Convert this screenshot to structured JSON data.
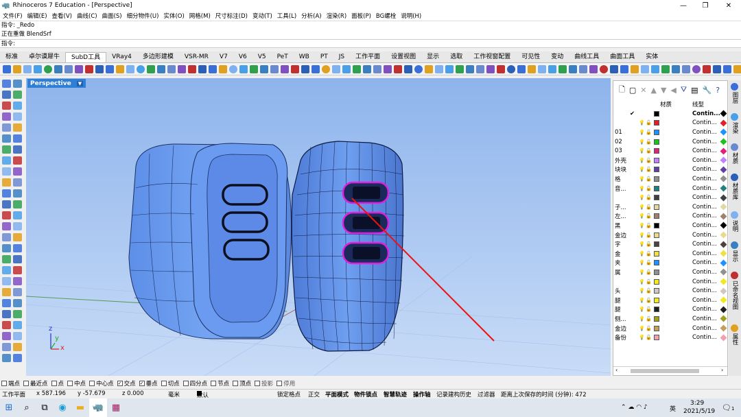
{
  "titlebar": {
    "title": "Rhinoceros 7 Education - [Perspective]",
    "min": "—",
    "max": "❐",
    "close": "✕"
  },
  "menu": [
    "文件(F)",
    "编辑(E)",
    "查看(V)",
    "曲线(C)",
    "曲面(S)",
    "细分物件(U)",
    "实体(O)",
    "网格(M)",
    "尺寸标注(D)",
    "变动(T)",
    "工具(L)",
    "分析(A)",
    "渲染(R)",
    "面板(P)",
    "BG螺栓",
    "说明(H)"
  ],
  "command_history": [
    "指令: _Redo",
    "正在重做 BlendSrf"
  ],
  "command_prompt": "指令:",
  "tabs": [
    "标准",
    "卓尔谟犀牛",
    "SubD工具",
    "VRay4",
    "多边形建模",
    "VSR-MR",
    "V7",
    "V6",
    "V5",
    "PeT",
    "WB",
    "PT",
    "JS",
    "工作平面",
    "设置视图",
    "显示",
    "选取",
    "工作视窗配置",
    "可见性",
    "变动",
    "曲线工具",
    "曲面工具",
    "实体"
  ],
  "active_tab": "SubD工具",
  "viewport": {
    "label": "Perspective",
    "axis_x": "x",
    "axis_y": "y",
    "axis_z": "z"
  },
  "layers": {
    "header_material": "材质",
    "header_linetype": "线型",
    "toolbar_icons": [
      "new-layer-icon",
      "new-sublayer-icon",
      "delete-icon",
      "move-up-icon",
      "move-down-icon",
      "move-parent-icon",
      "filter-icon",
      "properties-icon",
      "tools-icon",
      "help-icon"
    ],
    "rows": [
      {
        "name": "",
        "color": "#000000",
        "linetype": "Contin...",
        "current": true
      },
      {
        "name": "",
        "color": "#e0202a",
        "linetype": "Contin..."
      },
      {
        "name": "01",
        "color": "#1e90ff",
        "linetype": "Contin..."
      },
      {
        "name": "02",
        "color": "#20c020",
        "linetype": "Contin..."
      },
      {
        "name": "03",
        "color": "#e0207a",
        "linetype": "Contin..."
      },
      {
        "name": "外壳",
        "color": "#c080ff",
        "linetype": "Contin..."
      },
      {
        "name": "块块",
        "color": "#6040a0",
        "linetype": "Contin..."
      },
      {
        "name": "格",
        "color": "#909090",
        "linetype": "Contin..."
      },
      {
        "name": "音...",
        "color": "#208080",
        "linetype": "Contin..."
      },
      {
        "name": "",
        "color": "#404040",
        "linetype": "Contin..."
      },
      {
        "name": "子...",
        "color": "#e0d8a0",
        "linetype": "Contin..."
      },
      {
        "name": "左...",
        "color": "#a08070",
        "linetype": "Contin..."
      },
      {
        "name": "黑",
        "color": "#000000",
        "linetype": "Contin..."
      },
      {
        "name": "金边",
        "color": "#e8d890",
        "linetype": "Contin..."
      },
      {
        "name": "字",
        "color": "#504040",
        "linetype": "Contin..."
      },
      {
        "name": "金",
        "color": "#f0e040",
        "linetype": "Contin..."
      },
      {
        "name": "夹",
        "color": "#1e90ff",
        "linetype": "Contin..."
      },
      {
        "name": "属",
        "color": "#909090",
        "linetype": "Contin..."
      },
      {
        "name": "",
        "color": "#f0e820",
        "linetype": "Contin..."
      },
      {
        "name": "头",
        "color": "#d0c8c0",
        "linetype": "Contin..."
      },
      {
        "name": "腿",
        "color": "#f0e820",
        "linetype": "Contin..."
      },
      {
        "name": "腿",
        "color": "#202020",
        "linetype": "Contin..."
      },
      {
        "name": "侧...",
        "color": "#a0a020",
        "linetype": "Contin..."
      },
      {
        "name": "金边",
        "color": "#c0a060",
        "linetype": "Contin..."
      },
      {
        "name": "备份",
        "color": "#f0a0b0",
        "linetype": "Contin..."
      }
    ]
  },
  "side_tabs": [
    "图层",
    "渲染",
    "材质",
    "材质库",
    "说明",
    "显示",
    "已命名视图",
    "属性"
  ],
  "osnap": [
    {
      "label": "端点",
      "checked": false
    },
    {
      "label": "最近点",
      "checked": false
    },
    {
      "label": "点",
      "checked": false
    },
    {
      "label": "中点",
      "checked": false
    },
    {
      "label": "中心点",
      "checked": false
    },
    {
      "label": "交点",
      "checked": true
    },
    {
      "label": "垂点",
      "checked": true
    },
    {
      "label": "切点",
      "checked": false
    },
    {
      "label": "四分点",
      "checked": false
    },
    {
      "label": "节点",
      "checked": false
    },
    {
      "label": "顶点",
      "checked": false
    },
    {
      "label": "投影",
      "checked": false
    },
    {
      "label": "停用",
      "checked": false
    }
  ],
  "status": {
    "cplane": "工作平面",
    "x": "x 587.196",
    "y": "y -57.679",
    "z": "z 0.000",
    "unit": "毫米",
    "layer": "默认",
    "grid_snap": "锁定格点",
    "ortho": "正交",
    "planar": "平面模式",
    "osnap": "物件锁点",
    "smarttrack": "智慧轨迹",
    "gumball": "操作轴",
    "history": "记录建构历史",
    "filter": "过滤器",
    "autosave": "距离上次保存的时间 (分钟): 472"
  },
  "taskbar": {
    "time": "3:29",
    "date": "2021/5/19",
    "lang": "英",
    "notify": "1"
  },
  "colors": {
    "viewport_top": "#8eb4ec",
    "viewport_bottom": "#c9dcf7",
    "object": "#6f9ff0",
    "accent": "#2f7fd6",
    "annotation": "#ee1111",
    "selection": "#e020e0"
  }
}
